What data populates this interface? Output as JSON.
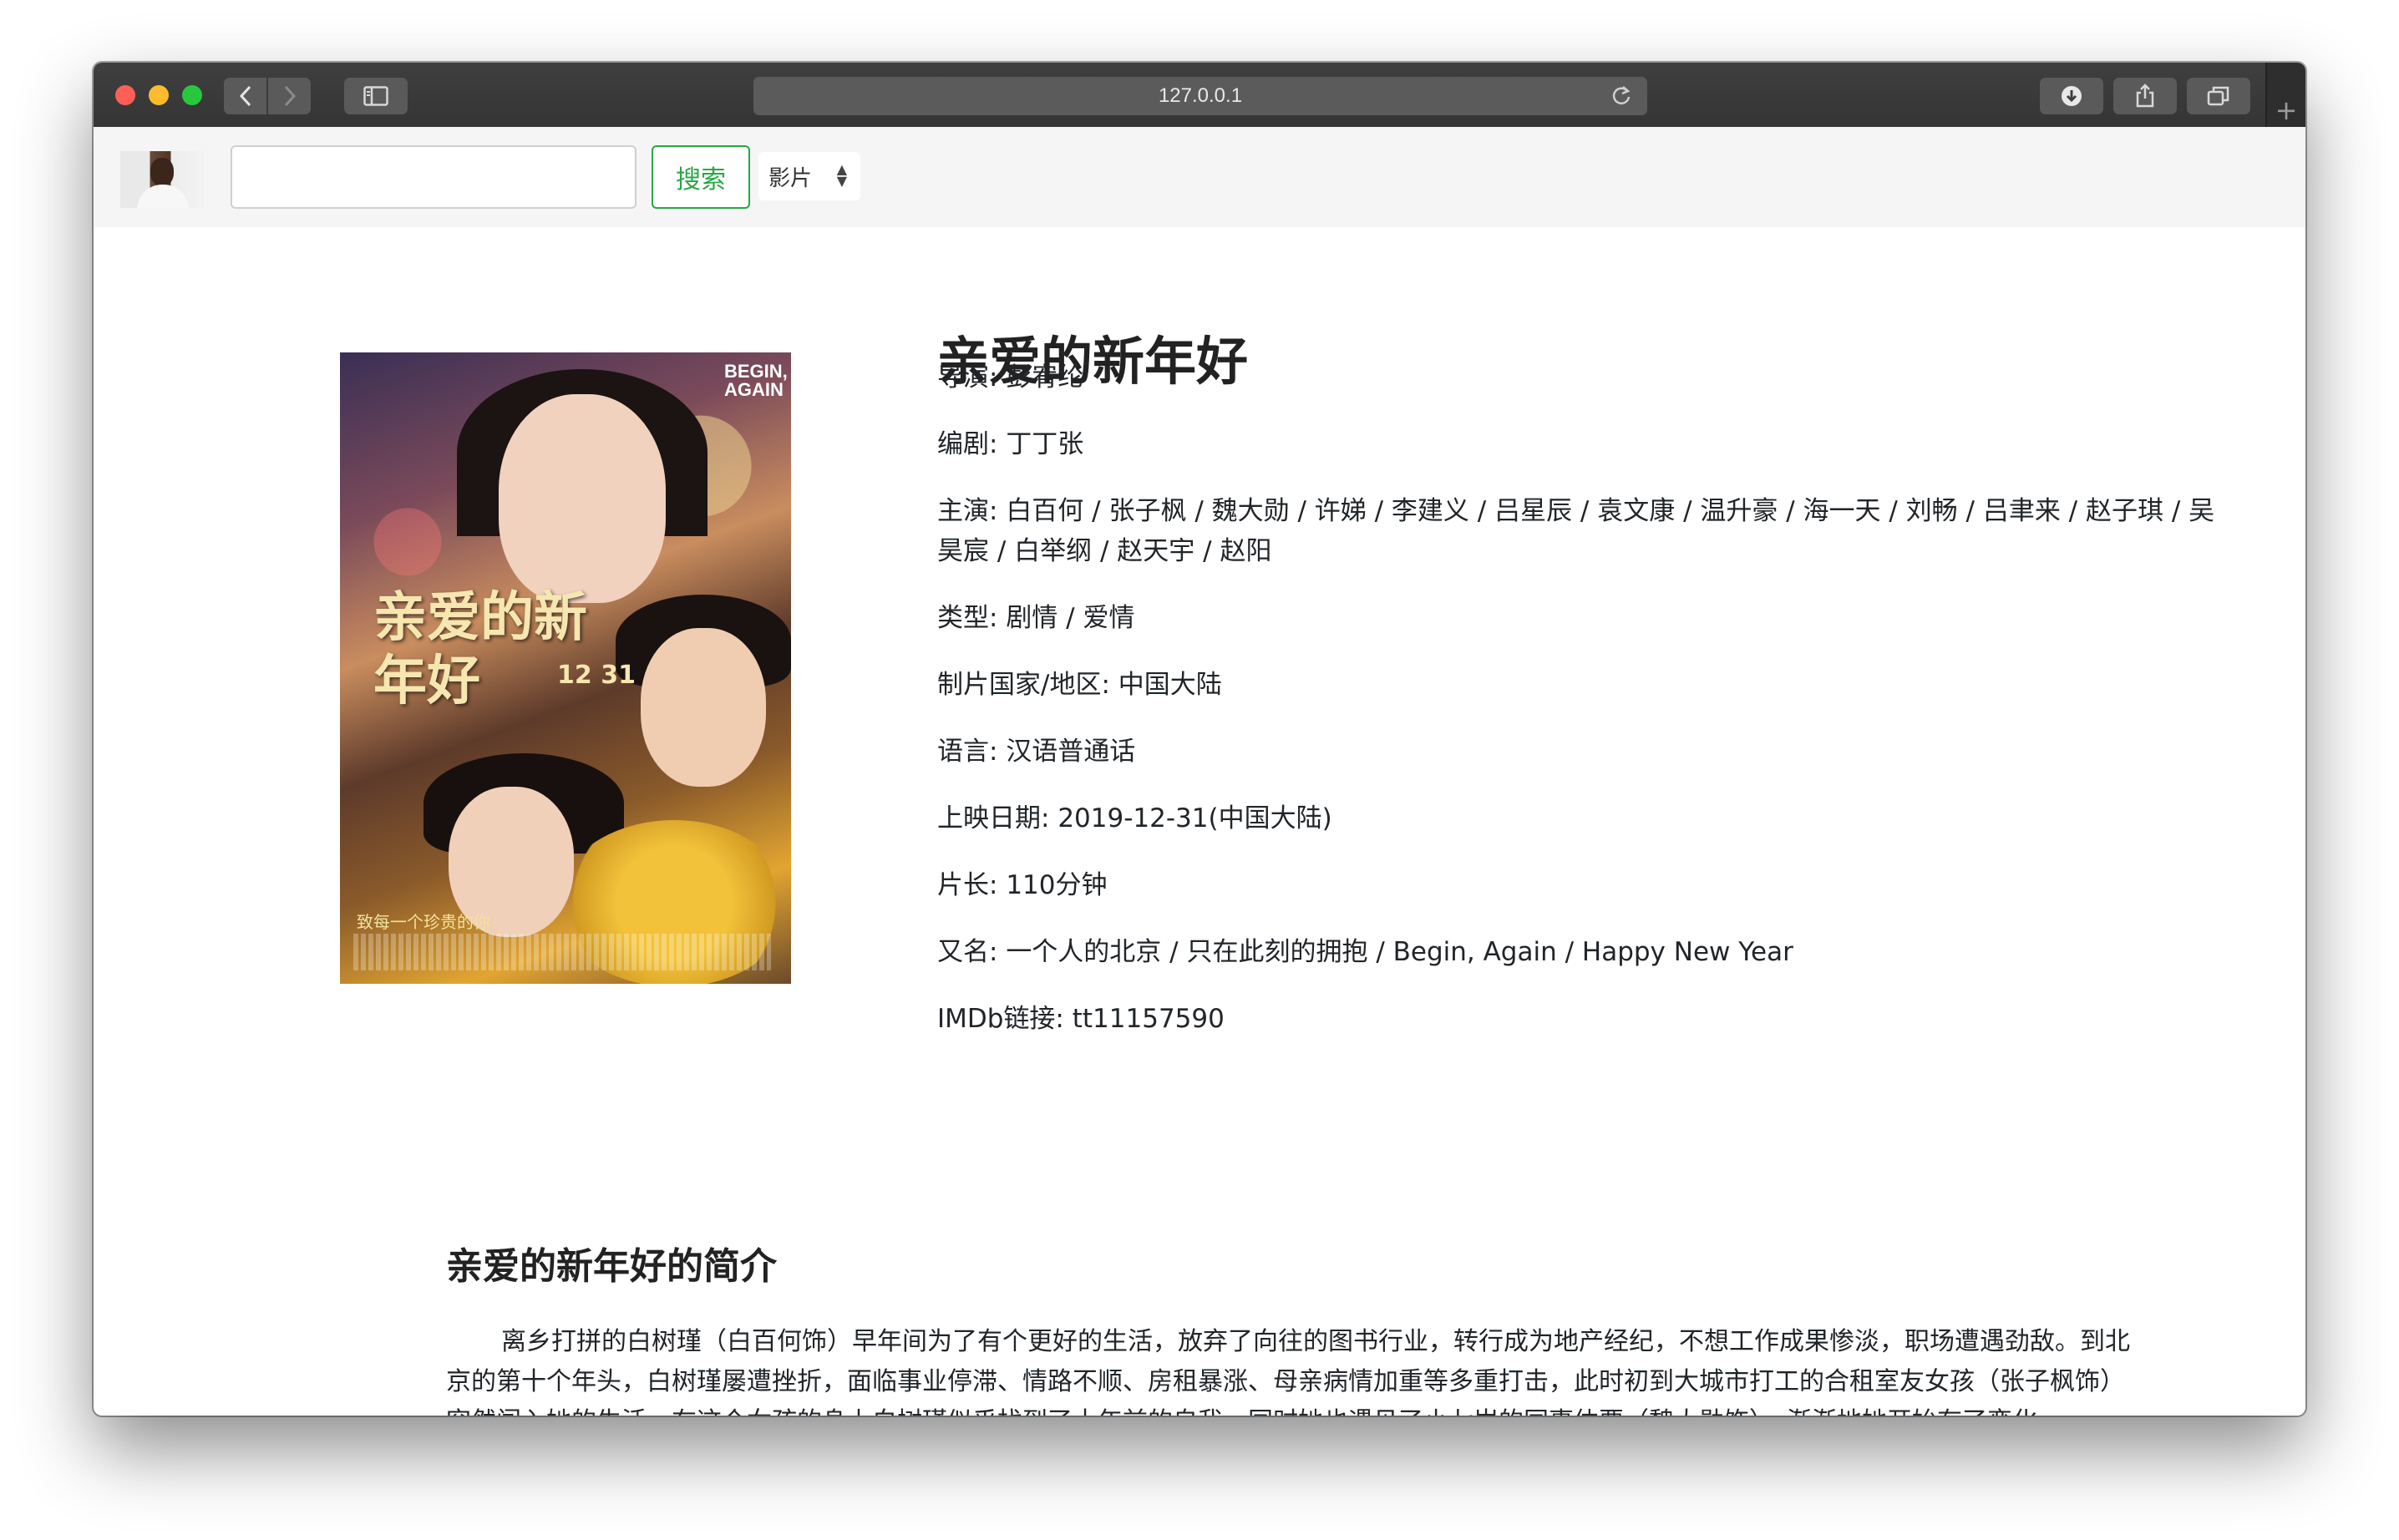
{
  "browser": {
    "url": "127.0.0.1",
    "back_icon": "chevron-left-icon",
    "forward_icon": "chevron-right-icon",
    "sidebar_icon": "sidebar-icon",
    "reload_icon": "reload-icon",
    "download_icon": "download-icon",
    "share_icon": "share-icon",
    "tabs_icon": "tabs-icon",
    "new_tab_icon": "plus-icon"
  },
  "toolbar": {
    "search_value": "",
    "search_button_label": "搜索",
    "type_selected": "影片",
    "accent_color": "#28a745"
  },
  "movie": {
    "title": "亲爱的新年好",
    "poster": {
      "title": "亲爱的新年好",
      "date": "12 31",
      "english": "BEGIN, AGAIN",
      "tagline": "致每一个珍贵的你"
    },
    "details": [
      {
        "key": "导演: ",
        "value": "彭宥纶"
      },
      {
        "key": "编剧: ",
        "value": "丁丁张"
      },
      {
        "key": "主演: ",
        "value": "白百何 / 张子枫 / 魏大勋 / 许娣 / 李建义 / 吕星辰 / 袁文康 / 温升豪 / 海一天 / 刘畅 / 吕聿来 / 赵子琪 / 吴昊宸 / 白举纲 / 赵天宇 / 赵阳"
      },
      {
        "key": "类型: ",
        "value": "剧情 / 爱情"
      },
      {
        "key": "制片国家/地区: ",
        "value": "中国大陆"
      },
      {
        "key": "语言: ",
        "value": "汉语普通话"
      },
      {
        "key": "上映日期: ",
        "value": "2019-12-31(中国大陆)"
      },
      {
        "key": "片长: ",
        "value": "110分钟"
      },
      {
        "key": "又名: ",
        "value": "一个人的北京 / 只在此刻的拥抱 / Begin, Again / Happy New Year"
      },
      {
        "key": "IMDb链接: ",
        "value": "tt11157590"
      }
    ]
  },
  "summary": {
    "title": "亲爱的新年好的简介",
    "text": "离乡打拼的白树瑾（白百何饰）早年间为了有个更好的生活，放弃了向往的图书行业，转行成为地产经纪，不想工作成果惨淡，职场遭遇劲敌。到北京的第十个年头，白树瑾屡遭挫折，面临事业停滞、情路不顺、房租暴涨、母亲病情加重等多重打击，此时初到大城市打工的合租室友女孩（张子枫饰）突然闯入她的生活，在这个女孩的身上白树瑾似乎找到了十年前的自我，同时她也遇见了小七岁的同事仲要（魏大勋饰），渐渐地她开始有了变化……"
  }
}
